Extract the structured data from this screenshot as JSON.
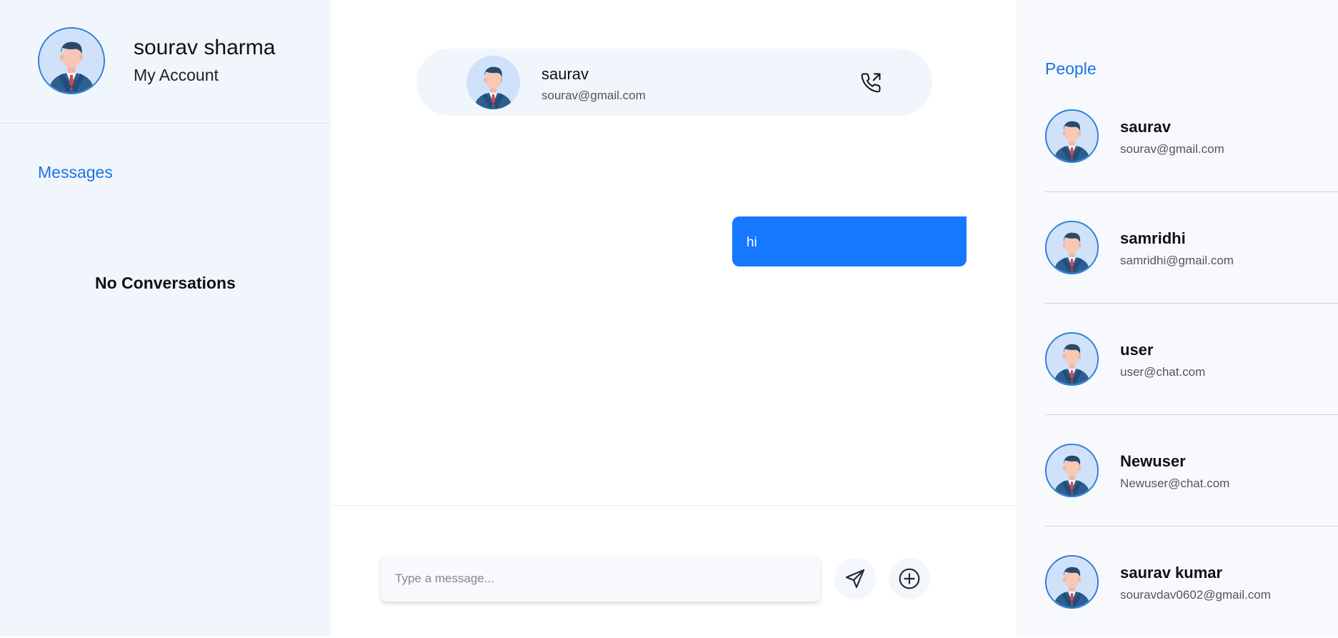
{
  "account": {
    "name": "sourav sharma",
    "subtitle": "My Account"
  },
  "sidebar": {
    "messages_title": "Messages",
    "empty_text": "No Conversations"
  },
  "chat": {
    "header": {
      "name": "saurav",
      "email": "sourav@gmail.com"
    },
    "messages": [
      {
        "text": "hi",
        "direction": "outgoing"
      }
    ],
    "input": {
      "placeholder": "Type a message...",
      "value": ""
    }
  },
  "people": {
    "title": "People",
    "items": [
      {
        "name": "saurav",
        "email": "sourav@gmail.com"
      },
      {
        "name": "samridhi",
        "email": "samridhi@gmail.com"
      },
      {
        "name": "user",
        "email": "user@chat.com"
      },
      {
        "name": "Newuser",
        "email": "Newuser@chat.com"
      },
      {
        "name": "saurav kumar",
        "email": "souravdav0602@gmail.com"
      }
    ]
  },
  "colors": {
    "accent": "#1677ff",
    "panel": "#f1f6fd",
    "link": "#1a73e8"
  },
  "icons": {
    "call": "phone-outgoing-icon",
    "send": "send-icon",
    "add": "plus-circle-icon"
  }
}
